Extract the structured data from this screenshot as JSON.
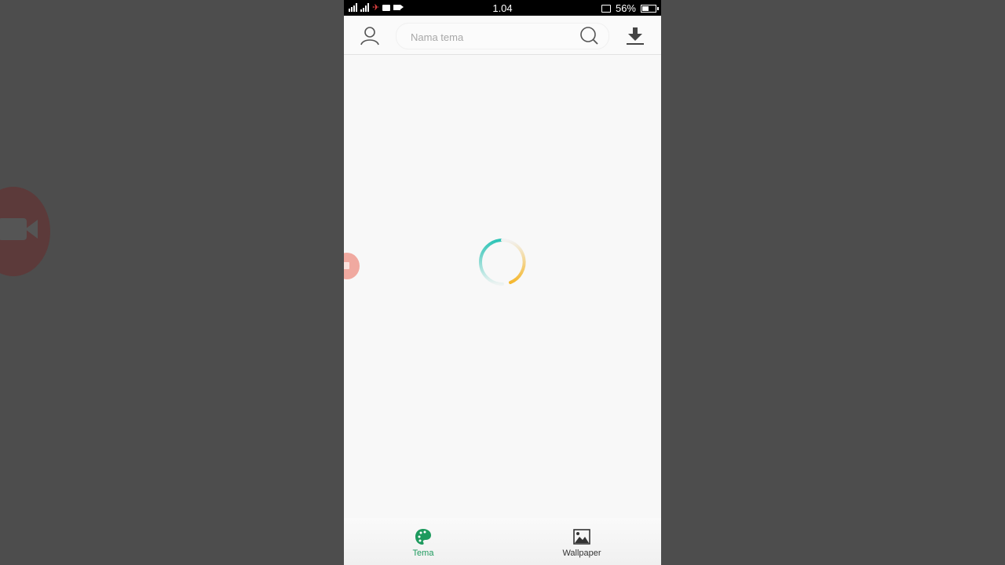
{
  "status_bar": {
    "time": "1.04",
    "battery_percent": "56%",
    "battery_level": 0.56,
    "icons": [
      "signal-icon",
      "signal-icon",
      "notification-icon",
      "message-icon",
      "video-icon",
      "cast-icon",
      "battery-icon"
    ]
  },
  "header": {
    "search_placeholder": "Nama tema",
    "search_value": "",
    "icons": {
      "profile": "user-icon",
      "search": "search-icon",
      "download": "download-icon"
    }
  },
  "content": {
    "state": "loading",
    "spinner_colors": {
      "start": "#2ec4b6",
      "end": "#f5b82e"
    }
  },
  "bottom_nav": {
    "items": [
      {
        "label": "Tema",
        "icon": "palette-icon",
        "active": true,
        "color": "#1e9a5e"
      },
      {
        "label": "Wallpaper",
        "icon": "image-icon",
        "active": false,
        "color": "#333333"
      }
    ]
  }
}
